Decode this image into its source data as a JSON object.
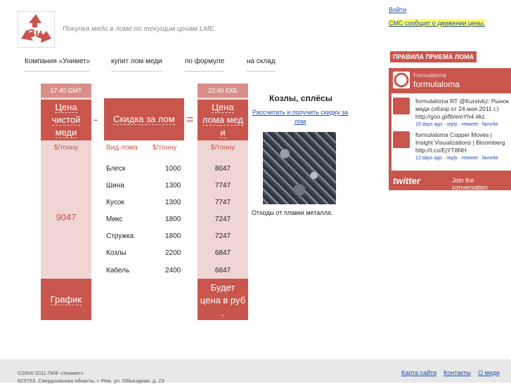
{
  "header": {
    "tagline": "Покупка меди в ломе по текущим ценам LME.",
    "login": "Войти",
    "sms": "СМС сообщит о движении цены.",
    "logo_text": "Cu"
  },
  "nav": [
    {
      "label": "Компания «Унимет»"
    },
    {
      "label": "купит лом меди"
    },
    {
      "label": "по формуле"
    },
    {
      "label": "на склад"
    }
  ],
  "rules_button": "ПРАВИЛА ПРИЕМА ЛОМА",
  "twitter": {
    "small_name": "Formulaloma",
    "name": "formulaloma",
    "tweets": [
      {
        "text": "formulaloma RT @Kursivkz: Рынок меди (обзор от 24 мая 2011 г.) http://goo.gl/fb/emYh4 #kz",
        "meta": "15 days ago · reply · retweet · favorite"
      },
      {
        "text": "formulaloma Copper Moves | Insight Visualizations | Bloomberg http://t.co/EjYT8NH",
        "meta": "12 days ago · reply · retweet · favorite"
      }
    ],
    "logo": "twitter",
    "join": "Join the conversation"
  },
  "prices": {
    "gmt_time": "17:40 GMT",
    "ekb_time": "22:40 ЕКБ",
    "clean_header": [
      "Цена",
      "чистой",
      "меди"
    ],
    "discount_header": "Скидка за лом",
    "scrap_header": [
      "Цена",
      "лома мед",
      "и"
    ],
    "minus": "-",
    "equals": "=",
    "unit": "$/тонну",
    "col_type": "Вид лома",
    "clean_price": "9047",
    "graph_button": "График",
    "rub_note": [
      "Будет",
      "цена в руб",
      "."
    ],
    "rows": [
      {
        "type": "Блеск",
        "discount": "1000",
        "price": "8047"
      },
      {
        "type": "Шина",
        "discount": "1300",
        "price": "7747"
      },
      {
        "type": "Кусок",
        "discount": "1300",
        "price": "7747"
      },
      {
        "type": "Микс",
        "discount": "1800",
        "price": "7247"
      },
      {
        "type": "Стружка",
        "discount": "1800",
        "price": "7247"
      },
      {
        "type": "Козлы",
        "discount": "2200",
        "price": "6847"
      },
      {
        "type": "Кабель",
        "discount": "2400",
        "price": "6647"
      }
    ]
  },
  "product": {
    "title": "Козлы, сплёсы",
    "link": "Рассчитать и получить скидку за лом",
    "description": "Отходы от плавки металла."
  },
  "footer": {
    "copyright": "©2004-2011 ПКФ «Унимет»",
    "address": "623753, Свердловская область, г. Реж, ул. Объездная, д. 23",
    "links": [
      "Карта сайта",
      "Контакты",
      "О меди"
    ]
  }
}
